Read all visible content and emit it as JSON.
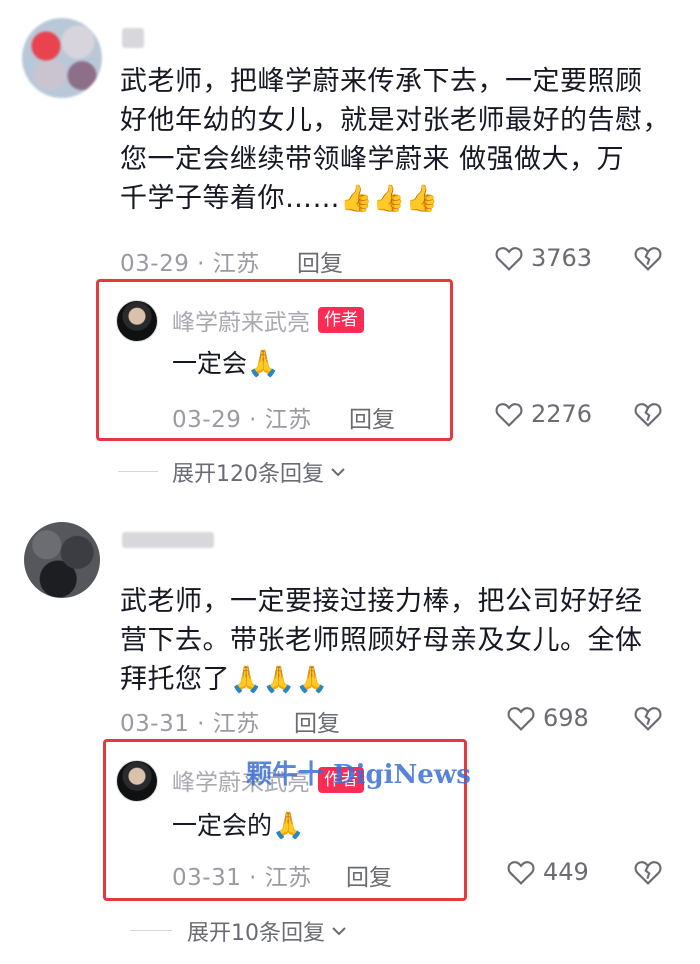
{
  "comments": [
    {
      "text_lines": [
        "武老师，把峰学蔚来传承下去，一定要照顾",
        "好他年幼的女儿，就是对张老师最好的告慰，",
        "您一定会继续带领峰学蔚来 做强做大，万",
        "千学子等着你……"
      ],
      "emojis": "👍👍👍",
      "meta": "03-29 · 江苏",
      "reply_label": "回复",
      "likes": "3763",
      "reply": {
        "author": "峰学蔚来武亮",
        "badge": "作者",
        "text": "一定会",
        "emoji": "🙏",
        "meta": "03-29 · 江苏",
        "reply_label": "回复",
        "likes": "2276"
      },
      "expand_label": "展开120条回复"
    },
    {
      "text_lines": [
        "武老师，一定要接过接力棒，把公司好好经",
        "营下去。带张老师照顾好母亲及女儿。全体",
        "拜托您了"
      ],
      "emojis": "🙏🙏🙏",
      "meta": "03-31 · 江苏",
      "reply_label": "回复",
      "likes": "698",
      "reply": {
        "author": "峰学蔚来武亮",
        "badge": "作者",
        "text": "一定会的",
        "emoji": "🙏",
        "meta": "03-31 · 江苏",
        "reply_label": "回复",
        "likes": "449"
      },
      "expand_label": "展开10条回复"
    }
  ],
  "watermark": "颗牛十 DigiNews",
  "icons": {
    "like": "heart-outline-icon",
    "dislike": "broken-heart-icon",
    "expand": "chevron-down-icon"
  },
  "colors": {
    "highlight_box": "#e6383f",
    "author_badge": "#fe2c55",
    "meta": "#9a9aa3"
  }
}
